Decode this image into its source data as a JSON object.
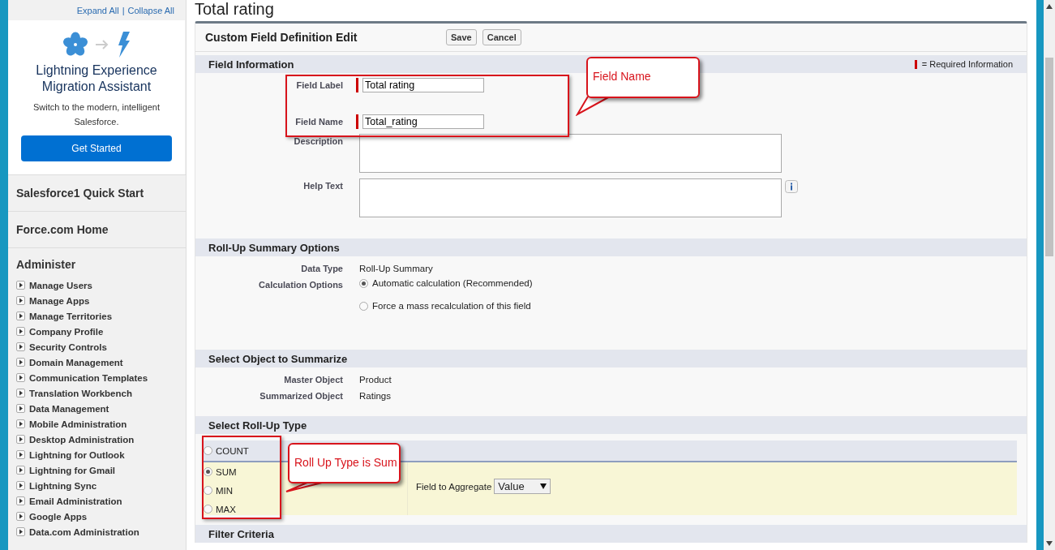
{
  "sidebar": {
    "expand_link": "Expand All",
    "separator": "|",
    "collapse_link": "Collapse All",
    "promo": {
      "title": "Lightning Experience Migration Assistant",
      "text": "Switch to the modern, intelligent Salesforce.",
      "button": "Get Started"
    },
    "links": [
      "Salesforce1 Quick Start",
      "Force.com Home"
    ],
    "section": {
      "title": "Administer",
      "items": [
        {
          "label": "Manage Users",
          "expanded": false
        },
        {
          "label": "Manage Apps",
          "expanded": false
        },
        {
          "label": "Manage Territories",
          "expanded": false
        },
        {
          "label": "Company Profile",
          "expanded": false
        },
        {
          "label": "Security Controls",
          "expanded": false
        },
        {
          "label": "Domain Management",
          "expanded": false
        },
        {
          "label": "Communication Templates",
          "expanded": false
        },
        {
          "label": "Translation Workbench",
          "expanded": false
        },
        {
          "label": "Data Management",
          "expanded": false
        },
        {
          "label": "Mobile Administration",
          "expanded": false
        },
        {
          "label": "Desktop Administration",
          "expanded": false
        },
        {
          "label": "Lightning for Outlook",
          "expanded": false
        },
        {
          "label": "Lightning for Gmail",
          "expanded": false
        },
        {
          "label": "Lightning Sync",
          "expanded": false
        },
        {
          "label": "Email Administration",
          "expanded": false
        },
        {
          "label": "Google Apps",
          "expanded": false
        },
        {
          "label": "Data.com Administration",
          "expanded": false
        }
      ]
    }
  },
  "page_title": "Total rating",
  "form": {
    "title": "Custom Field Definition Edit",
    "buttons": [
      "Save",
      "Cancel"
    ],
    "sections": [
      {
        "kind": "fields",
        "title": "Field Information",
        "legend": "= Required Information",
        "rows": [
          {
            "kind": "input",
            "label": "Field Label",
            "value": "Total rating",
            "required": true
          },
          {
            "kind": "input",
            "label": "Field Name",
            "value": "Total_rating",
            "required": true
          },
          {
            "kind": "textarea",
            "label": "Description"
          },
          {
            "kind": "textarea",
            "label": "Help Text",
            "info": true
          }
        ]
      },
      {
        "kind": "fields",
        "title": "Roll-Up Summary Options",
        "rows": [
          {
            "kind": "text",
            "label": "Data Type",
            "value": "Roll-Up Summary"
          },
          {
            "kind": "radios",
            "label": "Calculation Options",
            "options": [
              {
                "label": "Automatic calculation (Recommended)",
                "selected": true
              },
              {
                "label": "Force a mass recalculation of this field",
                "selected": false
              }
            ]
          }
        ]
      },
      {
        "kind": "fields",
        "title": "Select Object to Summarize",
        "rows": [
          {
            "kind": "text",
            "label": "Master Object",
            "value": "Product"
          },
          {
            "kind": "text",
            "label": "Summarized Object",
            "value": "Ratings"
          }
        ]
      },
      {
        "kind": "rollup",
        "title": "Select Roll-Up Type",
        "types": [
          {
            "label": "COUNT",
            "selected": false
          },
          {
            "label": "SUM",
            "selected": true
          },
          {
            "label": "MIN",
            "selected": false
          },
          {
            "label": "MAX",
            "selected": false
          }
        ],
        "aggregate_label": "Field to Aggregate",
        "aggregate_value": "Value"
      },
      {
        "kind": "header",
        "title": "Filter Criteria"
      }
    ]
  },
  "annotations": [
    {
      "text": "Field Name"
    },
    {
      "text": "Roll Up Type is Sum"
    }
  ]
}
